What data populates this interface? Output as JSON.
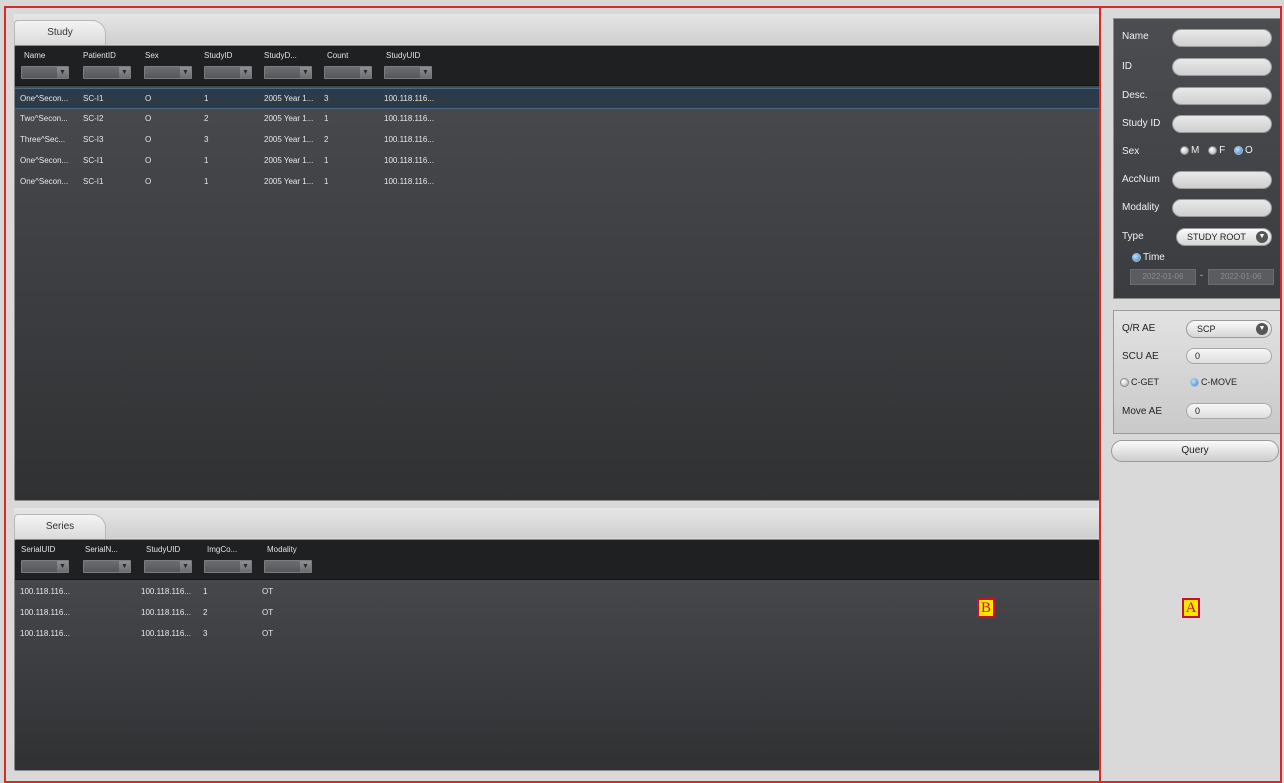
{
  "study": {
    "tab_label": "Study",
    "columns": [
      "Name",
      "PatientID",
      "Sex",
      "StudyID",
      "StudyD...",
      "Count",
      "StudyUID"
    ],
    "rows": [
      [
        "One^Secon...",
        "SC-I1",
        "O",
        "1",
        "2005 Year 1...",
        "3",
        "100.118.116..."
      ],
      [
        "Two^Secon...",
        "SC-I2",
        "O",
        "2",
        "2005 Year 1...",
        "1",
        "100.118.116..."
      ],
      [
        "Three^Sec...",
        "SC-I3",
        "O",
        "3",
        "2005 Year 1...",
        "2",
        "100.118.116..."
      ],
      [
        "One^Secon...",
        "SC-I1",
        "O",
        "1",
        "2005 Year 1...",
        "1",
        "100.118.116..."
      ],
      [
        "One^Secon...",
        "SC-I1",
        "O",
        "1",
        "2005 Year 1...",
        "1",
        "100.118.116..."
      ]
    ]
  },
  "series": {
    "tab_label": "Series",
    "columns": [
      "SerialUID",
      "SerialN...",
      "StudyUID",
      "ImgCo...",
      "Modality"
    ],
    "rows": [
      [
        "100.118.116...",
        "",
        "100.118.116...",
        "1",
        "OT"
      ],
      [
        "100.118.116...",
        "",
        "100.118.116...",
        "2",
        "OT"
      ],
      [
        "100.118.116...",
        "",
        "100.118.116...",
        "3",
        "OT"
      ]
    ]
  },
  "search": {
    "name_label": "Name",
    "id_label": "ID",
    "desc_label": "Desc.",
    "study_id_label": "Study ID",
    "sex_label": "Sex",
    "sex_m": "M",
    "sex_f": "F",
    "sex_o": "O",
    "accnum_label": "AccNum",
    "modality_label": "Modality",
    "type_label": "Type",
    "type_value": "STUDY ROOT",
    "time_label": "Time",
    "date_from": "2022-01-06",
    "date_sep": "-",
    "date_to": "2022-01-06"
  },
  "ae": {
    "qr_label": "Q/R AE",
    "qr_value": "SCP",
    "scu_label": "SCU AE",
    "scu_value": "0",
    "cget_label": "C-GET",
    "cmove_label": "C-MOVE",
    "move_label": "Move AE",
    "move_value": "0"
  },
  "query_label": "Query",
  "markers": {
    "a": "A",
    "b": "B"
  },
  "colors": {
    "annotation_red": "#d42a2a",
    "marker_yellow": "#ffe600",
    "radio_blue": "#3b7fc1"
  }
}
